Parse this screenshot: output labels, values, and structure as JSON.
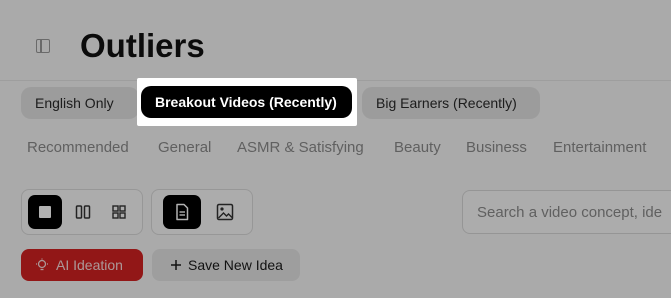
{
  "page": {
    "title": "Outliers"
  },
  "chips": [
    {
      "label": "English Only",
      "active": false
    },
    {
      "label": "Breakout Videos (Recently)",
      "active": true
    },
    {
      "label": "Big Earners (Recently)",
      "active": false
    }
  ],
  "categories": [
    "Recommended",
    "General",
    "ASMR & Satisfying",
    "Beauty",
    "Business",
    "Entertainment"
  ],
  "toolbar": {
    "layout_icons": [
      "single-column-icon",
      "two-column-icon",
      "grid-icon"
    ],
    "view_icons": [
      "document-icon",
      "image-icon"
    ]
  },
  "search": {
    "placeholder": "Search a video concept, ide"
  },
  "actions": {
    "ai_ideation_label": "AI Ideation",
    "save_idea_label": "Save New Idea"
  },
  "colors": {
    "accent_red": "#d12121",
    "active_chip": "#000000"
  }
}
